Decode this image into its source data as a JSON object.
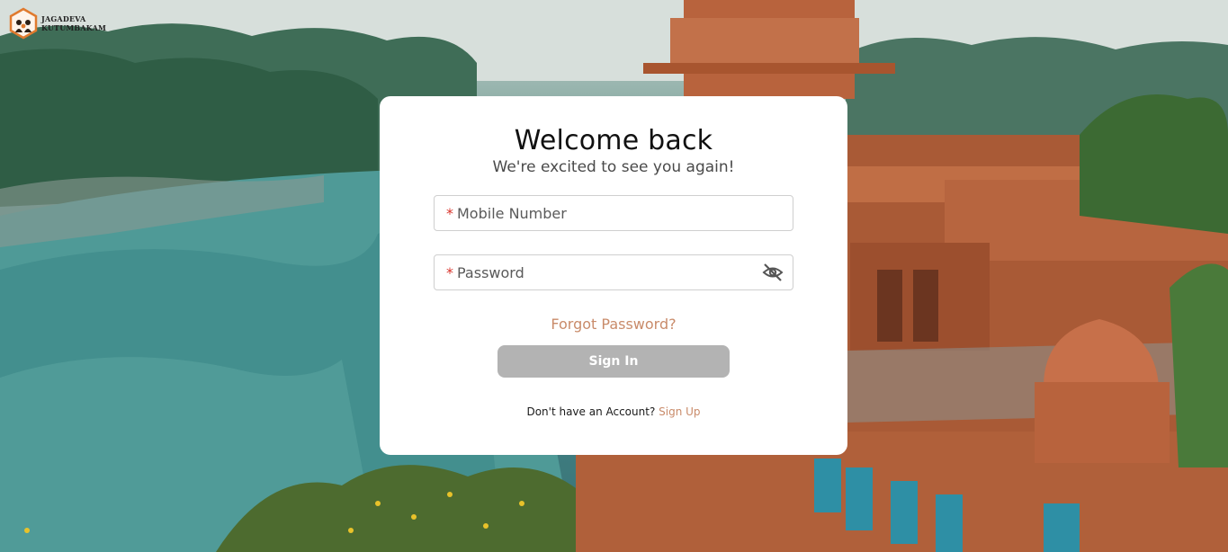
{
  "brand": {
    "line1": "JAGADEVA",
    "line2": "KUTUMBAKAM"
  },
  "card": {
    "title": "Welcome back",
    "subtitle": "We're excited to see you again!",
    "mobile": {
      "required_mark": "*",
      "placeholder": "Mobile Number",
      "value": ""
    },
    "password": {
      "required_mark": "*",
      "placeholder": "Password",
      "value": "",
      "toggle_icon": "eye-off-icon"
    },
    "forgot_label": "Forgot Password?",
    "signin_label": "Sign In",
    "signup_prompt": "Don't have an Account?",
    "signup_label": "Sign Up"
  },
  "colors": {
    "accent": "#c98b6a",
    "required": "#d9342b",
    "button_disabled": "#b3b3b3",
    "logo_orange": "#e07a2e"
  }
}
